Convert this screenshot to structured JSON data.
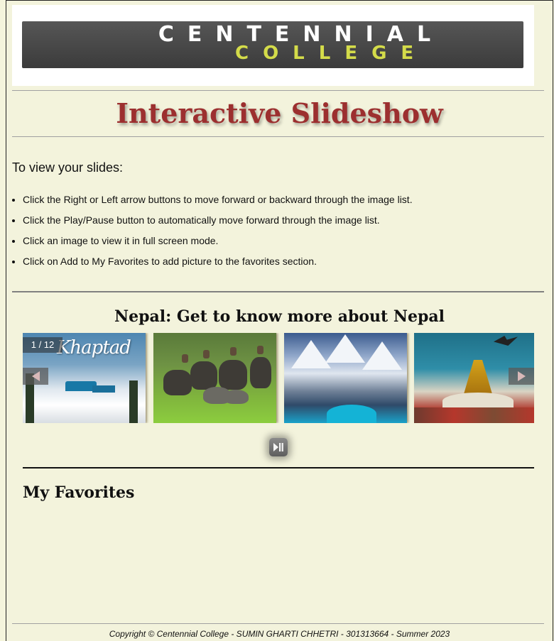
{
  "header": {
    "logo_line1": "CENTENNIAL",
    "logo_line2": "COLLEGE"
  },
  "page_title": "Interactive Slideshow",
  "instructions": {
    "heading": "To view your slides:",
    "items": [
      "Click the Right or Left arrow buttons to move forward or backward through the image list.",
      "Click the Play/Pause button to automatically move forward through the image list.",
      "Click an image to view it in full screen mode.",
      "Click on Add to My Favorites to add picture to the favorites section."
    ]
  },
  "slideshow": {
    "title": "Nepal: Get to know more about Nepal",
    "counter": "1 / 12",
    "slide1_caption": "Khaptad",
    "controls": {
      "prev_icon": "triangle-left-icon",
      "next_icon": "triangle-right-icon",
      "playpause_icon": "play-pause-icon"
    }
  },
  "favorites": {
    "title": "My Favorites"
  },
  "footer": {
    "text": "Copyright © Centennial College - SUMIN GHARTI CHHETRI - 301313664 - Summer 2023"
  },
  "colors": {
    "page_bg": "#f3f3dc",
    "title_color": "#9c2f2f",
    "logo_accent": "#d4dc4a"
  }
}
